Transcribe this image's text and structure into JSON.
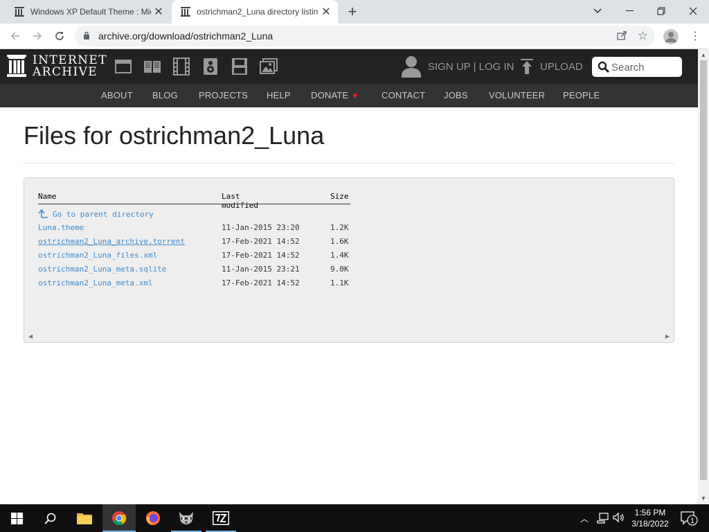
{
  "browser": {
    "tabs": [
      {
        "title": "Windows XP Default Theme : Mic",
        "active": false
      },
      {
        "title": "ostrichman2_Luna directory listin",
        "active": true
      }
    ],
    "url": "archive.org/download/ostrichman2_Luna"
  },
  "ia": {
    "logo_line1": "INTERNET",
    "logo_line2": "ARCHIVE",
    "media_icons": [
      "web-icon",
      "texts-icon",
      "video-icon",
      "audio-icon",
      "software-icon",
      "images-icon"
    ],
    "signup_login": "SIGN UP | LOG IN",
    "upload": "UPLOAD",
    "search_placeholder": "Search",
    "nav": [
      "ABOUT",
      "BLOG",
      "PROJECTS",
      "HELP",
      "DONATE",
      "CONTACT",
      "JOBS",
      "VOLUNTEER",
      "PEOPLE"
    ]
  },
  "page": {
    "title": "Files for ostrichman2_Luna",
    "columns": {
      "name": "Name",
      "modified": "Last modified",
      "size": "Size"
    },
    "parent_link": "Go to parent directory",
    "files": [
      {
        "name": "Luna.theme",
        "modified": "11-Jan-2015 23:20",
        "size": "1.2K"
      },
      {
        "name": "ostrichman2_Luna_archive.torrent",
        "modified": "17-Feb-2021 14:52",
        "size": "1.6K"
      },
      {
        "name": "ostrichman2_Luna_files.xml",
        "modified": "17-Feb-2021 14:52",
        "size": "1.4K"
      },
      {
        "name": "ostrichman2_Luna_meta.sqlite",
        "modified": "11-Jan-2015 23:21",
        "size": "9.0K"
      },
      {
        "name": "ostrichman2_Luna_meta.xml",
        "modified": "17-Feb-2021 14:52",
        "size": "1.1K"
      }
    ]
  },
  "taskbar": {
    "apps": [
      "file-explorer-icon",
      "chrome-icon",
      "firefox-icon",
      "raccoon-app-icon",
      "7zip-icon"
    ],
    "time": "1:56 PM",
    "date": "3/18/2022",
    "notification_count": "1"
  },
  "colors": {
    "ia_top_bar": "#222222",
    "ia_sub_bar": "#333333",
    "link": "#428bca",
    "donate_heart": "#ee2222"
  }
}
